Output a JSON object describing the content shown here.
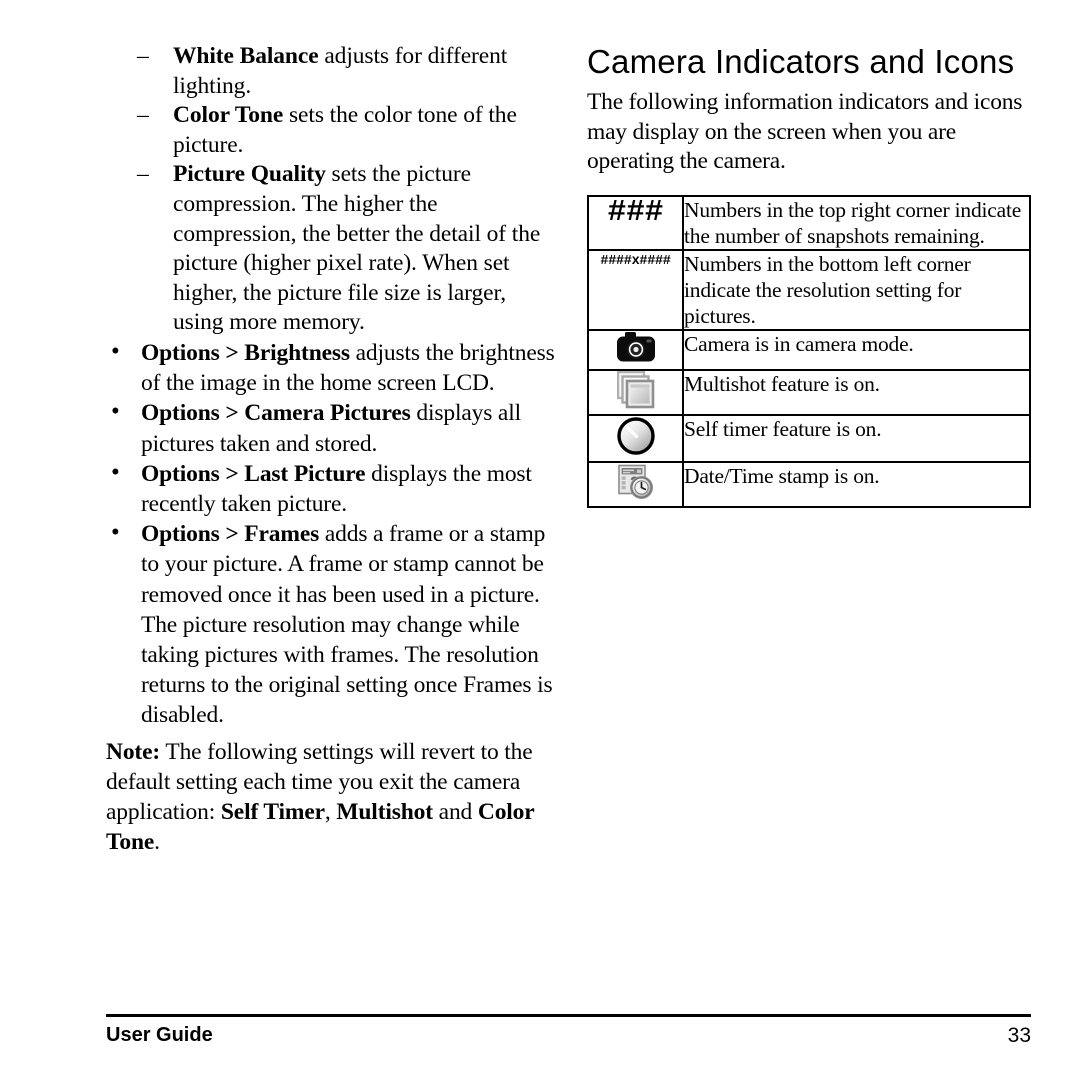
{
  "document": {
    "page_number": "33",
    "footer_label": "User Guide"
  },
  "left_column": {
    "sub_items": [
      {
        "marker": "–",
        "bold": "White Balance",
        "rest": " adjusts for different lighting."
      },
      {
        "marker": "–",
        "bold": "Color Tone",
        "rest": " sets the color tone of the picture."
      },
      {
        "marker": "–",
        "bold": "Picture Quality",
        "rest": " sets the picture compression. The higher the compression, the better the detail of the picture (higher pixel rate). When set higher, the picture file size is larger, using more memory."
      }
    ],
    "bullet_items": [
      {
        "marker": "•",
        "bold": "Options > Brightness",
        "rest": " adjusts the brightness of the image in the home screen LCD."
      },
      {
        "marker": "•",
        "bold": "Options > Camera Pictures",
        "rest": " displays all pictures taken and stored."
      },
      {
        "marker": "•",
        "bold": "Options > Last Picture",
        "rest": " displays the most recently taken picture."
      },
      {
        "marker": "•",
        "bold": "Options > Frames",
        "rest": " adds a frame or a stamp to your picture. A frame or stamp cannot be removed once it has been used in a picture. The picture resolution may change while taking pictures with frames. The resolution returns to the original setting once Frames is disabled."
      }
    ],
    "note": {
      "label": "Note:",
      "text_1": " The following settings will revert to the default setting each time you exit the camera application: ",
      "bold_1": "Self Timer",
      "text_2": ", ",
      "bold_2": "Multishot",
      "text_3": " and ",
      "bold_3": "Color Tone",
      "text_4": "."
    }
  },
  "right_column": {
    "title": "Camera Indicators and Icons",
    "intro": "The following information indicators and icons may display on the screen when you are operating the camera.",
    "table": {
      "rows": [
        {
          "icon_type": "text",
          "icon_text": "###",
          "icon_name": "hash-count-indicator",
          "description": "Numbers in the top right corner indicate the number of snapshots remaining."
        },
        {
          "icon_type": "text-small",
          "icon_text": "####x####",
          "icon_name": "resolution-indicator",
          "description": "Numbers in the bottom left corner indicate the resolution setting for pictures."
        },
        {
          "icon_type": "graphic",
          "icon_text": "",
          "icon_name": "camera-icon",
          "description": "Camera is in camera mode."
        },
        {
          "icon_type": "graphic",
          "icon_text": "",
          "icon_name": "multishot-icon",
          "description": "Multishot feature is on."
        },
        {
          "icon_type": "graphic",
          "icon_text": "",
          "icon_name": "self-timer-icon",
          "description": "Self timer feature is on."
        },
        {
          "icon_type": "graphic",
          "icon_text": "",
          "icon_name": "date-time-stamp-icon",
          "description": "Date/Time stamp is on."
        }
      ]
    }
  },
  "colors": {
    "text": "#000000",
    "background": "#ffffff",
    "rule": "#000000"
  }
}
